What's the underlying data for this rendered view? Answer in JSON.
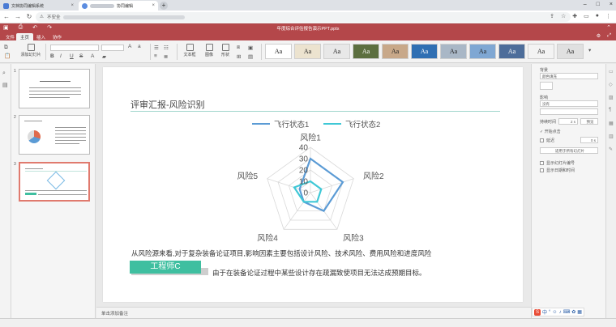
{
  "browser": {
    "tabs": [
      {
        "title": "文档协同编辑系统",
        "active": false
      },
      {
        "title": "协同编辑",
        "active": true
      }
    ],
    "new_tab_label": "+",
    "address_prefix": "不安全"
  },
  "app": {
    "title": "年度综合评估报告演示PPT.pptx"
  },
  "menu": [
    "文件",
    "主页",
    "插入",
    "协作"
  ],
  "ribbon": {
    "add_slide": "添加幻灯片",
    "textbox": "文本框",
    "picture": "图像",
    "shape": "形状",
    "theme_label": "Aa"
  },
  "thumbnails": {
    "numbers": [
      "1",
      "2",
      "3"
    ]
  },
  "slide": {
    "title": "评审汇报-风险识别",
    "paragraph_line1": "从风险源来看,对于复杂装备论证项目,影响因素主要包括设计风险、技术风险、费用风险和进度风险",
    "paragraph_line2": "由于在装备论证过程中某些设计存在疏漏致使项目无法达成预期目标。",
    "badge": "工程师C"
  },
  "notes_placeholder": "单击添加备注",
  "right_panel": {
    "background_label": "背景",
    "fill_value": "颜色填充",
    "transition_label": "影响",
    "transition_value": "没有",
    "duration_label": "持续时间",
    "duration_value": "2 s",
    "preview": "预览",
    "start_on_click": "开始点击",
    "delay": "延迟",
    "delay_value": "0 s",
    "apply_all": "适用于所有幻灯片",
    "show_slide_number": "显示幻灯片编号",
    "show_date_time": "显示日期和时间"
  },
  "chart_data": {
    "type": "radar",
    "categories": [
      "风险1",
      "风险2",
      "风险3",
      "风险4",
      "风险5"
    ],
    "series": [
      {
        "name": "飞行状态1",
        "color": "#5b9bd5",
        "values": [
          30,
          30,
          20,
          10,
          10
        ]
      },
      {
        "name": "飞行状态2",
        "color": "#3fc8d6",
        "values": [
          10,
          10,
          10,
          10,
          15
        ]
      }
    ],
    "rlim": [
      0,
      40
    ],
    "rticks": [
      "0",
      "10",
      "20",
      "30",
      "40"
    ],
    "legend_position": "top"
  },
  "colors": {
    "accent": "#b4474a",
    "badge": "#3fbfa0",
    "title_rule": "#9fd6cc"
  }
}
